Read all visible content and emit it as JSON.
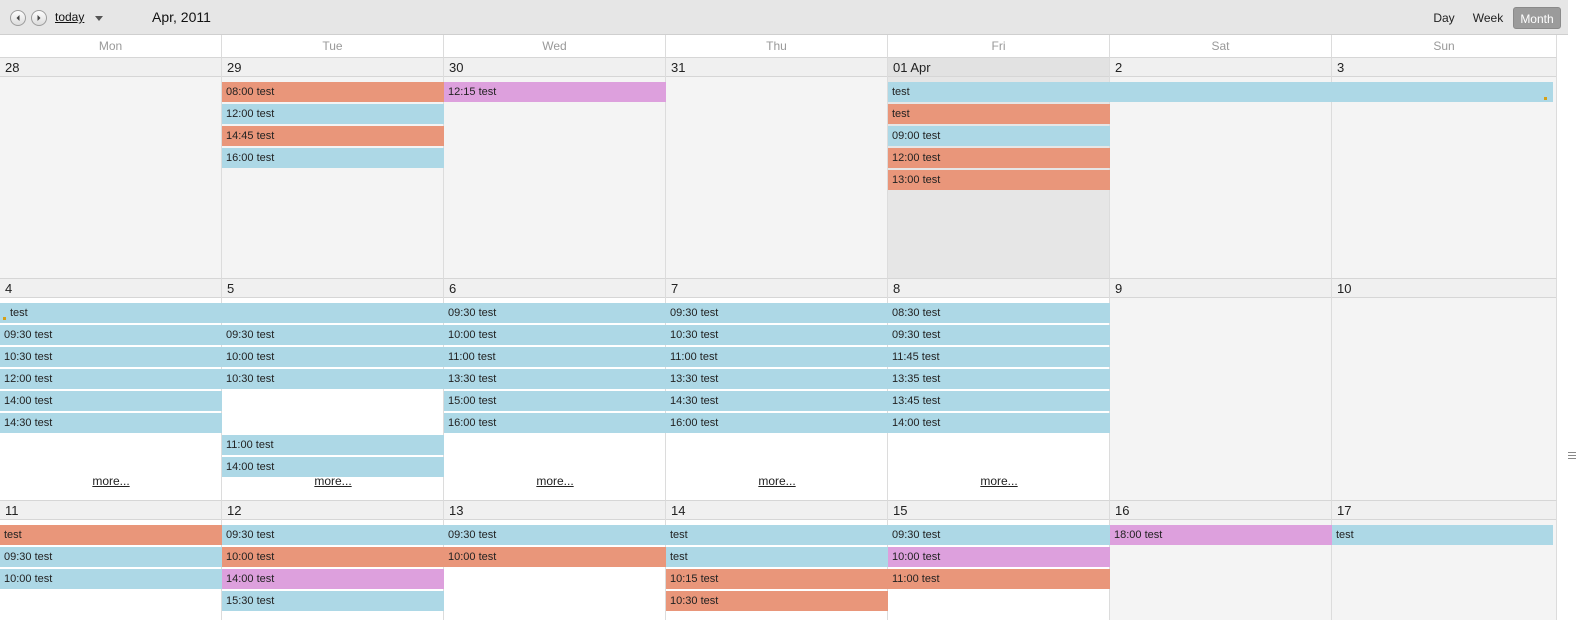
{
  "toolbar": {
    "today_label": "today",
    "title": "Apr, 2011",
    "views": [
      "Day",
      "Week",
      "Month"
    ],
    "active_view": "Month"
  },
  "weekdays": [
    "Mon",
    "Tue",
    "Wed",
    "Thu",
    "Fri",
    "Sat",
    "Sun"
  ],
  "more_label": "more...",
  "colors": {
    "blue": "#add8e6",
    "orange": "#e9967a",
    "pink": "#dda0dd"
  },
  "weeks": [
    {
      "days": [
        "28",
        "29",
        "30",
        "31",
        "01 Apr",
        "2",
        "3"
      ],
      "today_index": 4,
      "events": [
        {
          "col": 1,
          "span": 1,
          "row": 0,
          "label": "08:00 test",
          "color": "orange"
        },
        {
          "col": 1,
          "span": 1,
          "row": 1,
          "label": "12:00 test",
          "color": "blue"
        },
        {
          "col": 1,
          "span": 1,
          "row": 2,
          "label": "14:45 test",
          "color": "orange"
        },
        {
          "col": 1,
          "span": 1,
          "row": 3,
          "label": "16:00 test",
          "color": "blue"
        },
        {
          "col": 2,
          "span": 1,
          "row": 0,
          "label": "12:15 test",
          "color": "pink"
        },
        {
          "col": 4,
          "span": 3,
          "row": 0,
          "label": "test",
          "color": "blue"
        },
        {
          "col": 4,
          "span": 1,
          "row": 1,
          "label": "test",
          "color": "orange"
        },
        {
          "col": 4,
          "span": 1,
          "row": 2,
          "label": "09:00 test",
          "color": "blue"
        },
        {
          "col": 4,
          "span": 1,
          "row": 3,
          "label": "12:00 test",
          "color": "orange"
        },
        {
          "col": 4,
          "span": 1,
          "row": 4,
          "label": "13:00 test",
          "color": "orange"
        }
      ],
      "more_cols": []
    },
    {
      "days": [
        "4",
        "5",
        "6",
        "7",
        "8",
        "9",
        "10"
      ],
      "today_index": -1,
      "events": [
        {
          "col": 0,
          "span": 2,
          "row": 0,
          "label": "test",
          "color": "blue"
        },
        {
          "col": 0,
          "span": 1,
          "row": 1,
          "label": "09:30 test",
          "color": "blue"
        },
        {
          "col": 0,
          "span": 1,
          "row": 2,
          "label": "10:30 test",
          "color": "blue"
        },
        {
          "col": 0,
          "span": 1,
          "row": 3,
          "label": "12:00 test",
          "color": "blue"
        },
        {
          "col": 0,
          "span": 1,
          "row": 4,
          "label": "14:00 test",
          "color": "blue"
        },
        {
          "col": 0,
          "span": 1,
          "row": 5,
          "label": "14:30 test",
          "color": "blue"
        },
        {
          "col": 1,
          "span": 1,
          "row": 1,
          "label": "09:30 test",
          "color": "blue"
        },
        {
          "col": 1,
          "span": 1,
          "row": 2,
          "label": "10:00 test",
          "color": "blue"
        },
        {
          "col": 1,
          "span": 1,
          "row": 3,
          "label": "10:30 test",
          "color": "blue"
        },
        {
          "col": 1,
          "span": 1,
          "row": 6,
          "label": "11:00 test",
          "color": "blue"
        },
        {
          "col": 1,
          "span": 1,
          "row": 7,
          "label": "14:00 test",
          "color": "blue"
        },
        {
          "col": 2,
          "span": 1,
          "row": 0,
          "label": "09:30 test",
          "color": "blue"
        },
        {
          "col": 2,
          "span": 1,
          "row": 1,
          "label": "10:00 test",
          "color": "blue"
        },
        {
          "col": 2,
          "span": 1,
          "row": 2,
          "label": "11:00 test",
          "color": "blue"
        },
        {
          "col": 2,
          "span": 1,
          "row": 3,
          "label": "13:30 test",
          "color": "blue"
        },
        {
          "col": 2,
          "span": 1,
          "row": 4,
          "label": "15:00 test",
          "color": "blue"
        },
        {
          "col": 2,
          "span": 1,
          "row": 5,
          "label": "16:00 test",
          "color": "blue"
        },
        {
          "col": 3,
          "span": 1,
          "row": 0,
          "label": "09:30 test",
          "color": "blue"
        },
        {
          "col": 3,
          "span": 1,
          "row": 1,
          "label": "10:30 test",
          "color": "blue"
        },
        {
          "col": 3,
          "span": 1,
          "row": 2,
          "label": "11:00 test",
          "color": "blue"
        },
        {
          "col": 3,
          "span": 1,
          "row": 3,
          "label": "13:30 test",
          "color": "blue"
        },
        {
          "col": 3,
          "span": 1,
          "row": 4,
          "label": "14:30 test",
          "color": "blue"
        },
        {
          "col": 3,
          "span": 1,
          "row": 5,
          "label": "16:00 test",
          "color": "blue"
        },
        {
          "col": 4,
          "span": 1,
          "row": 0,
          "label": "08:30 test",
          "color": "blue"
        },
        {
          "col": 4,
          "span": 1,
          "row": 1,
          "label": "09:30 test",
          "color": "blue"
        },
        {
          "col": 4,
          "span": 1,
          "row": 2,
          "label": "11:45 test",
          "color": "blue"
        },
        {
          "col": 4,
          "span": 1,
          "row": 3,
          "label": "13:35 test",
          "color": "blue"
        },
        {
          "col": 4,
          "span": 1,
          "row": 4,
          "label": "13:45 test",
          "color": "blue"
        },
        {
          "col": 4,
          "span": 1,
          "row": 5,
          "label": "14:00 test",
          "color": "blue"
        }
      ],
      "more_cols": [
        0,
        1,
        2,
        3,
        4
      ]
    },
    {
      "days": [
        "11",
        "12",
        "13",
        "14",
        "15",
        "16",
        "17"
      ],
      "today_index": -1,
      "events": [
        {
          "col": 0,
          "span": 1,
          "row": 0,
          "label": "test",
          "color": "orange"
        },
        {
          "col": 0,
          "span": 1,
          "row": 1,
          "label": "09:30 test",
          "color": "blue"
        },
        {
          "col": 0,
          "span": 1,
          "row": 2,
          "label": "10:00 test",
          "color": "blue"
        },
        {
          "col": 1,
          "span": 1,
          "row": 0,
          "label": "09:30 test",
          "color": "blue"
        },
        {
          "col": 1,
          "span": 1,
          "row": 1,
          "label": "10:00 test",
          "color": "orange"
        },
        {
          "col": 1,
          "span": 1,
          "row": 2,
          "label": "14:00 test",
          "color": "pink"
        },
        {
          "col": 1,
          "span": 1,
          "row": 3,
          "label": "15:30 test",
          "color": "blue"
        },
        {
          "col": 2,
          "span": 1,
          "row": 0,
          "label": "09:30 test",
          "color": "blue"
        },
        {
          "col": 2,
          "span": 1,
          "row": 1,
          "label": "10:00 test",
          "color": "orange"
        },
        {
          "col": 3,
          "span": 1,
          "row": 0,
          "label": "test",
          "color": "blue"
        },
        {
          "col": 3,
          "span": 1,
          "row": 1,
          "label": "test",
          "color": "blue"
        },
        {
          "col": 3,
          "span": 1,
          "row": 2,
          "label": "10:15 test",
          "color": "orange"
        },
        {
          "col": 3,
          "span": 1,
          "row": 3,
          "label": "10:30 test",
          "color": "orange"
        },
        {
          "col": 4,
          "span": 1,
          "row": 0,
          "label": "09:30 test",
          "color": "blue"
        },
        {
          "col": 4,
          "span": 1,
          "row": 1,
          "label": "10:00 test",
          "color": "pink"
        },
        {
          "col": 4,
          "span": 1,
          "row": 2,
          "label": "11:00 test",
          "color": "orange"
        },
        {
          "col": 5,
          "span": 1,
          "row": 0,
          "label": "18:00 test",
          "color": "pink"
        },
        {
          "col": 6,
          "span": 1,
          "row": 0,
          "label": "test",
          "color": "blue"
        }
      ],
      "more_cols": []
    }
  ]
}
